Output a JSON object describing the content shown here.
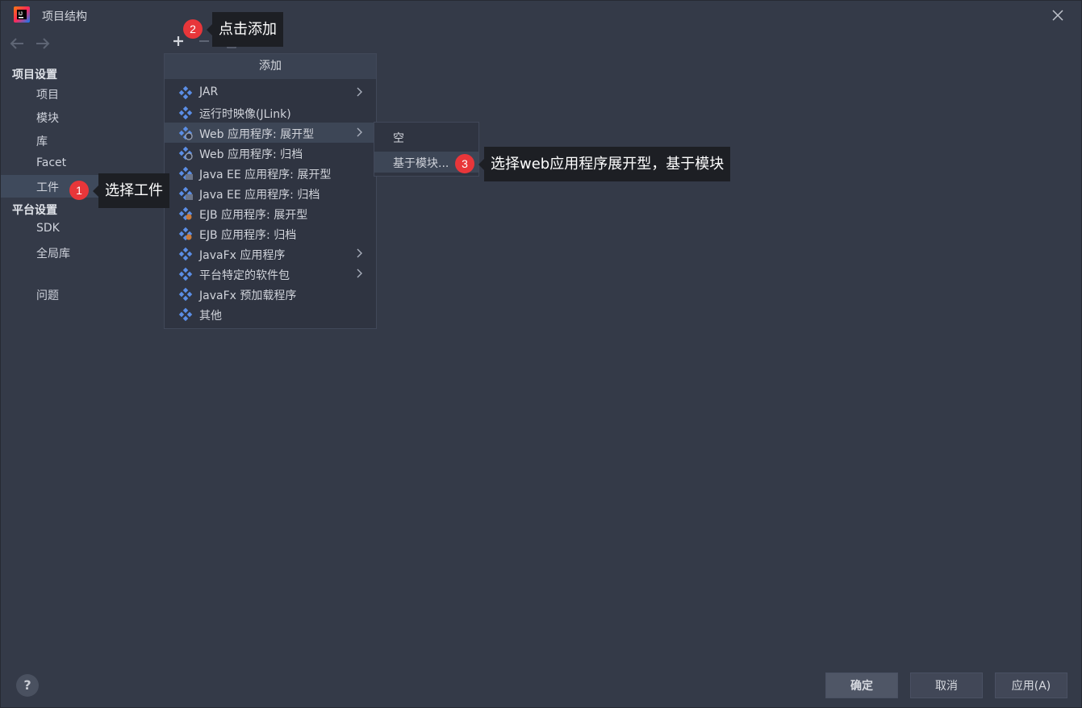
{
  "window": {
    "title": "项目结构",
    "app_icon": "intellij-icon",
    "close_icon": "close-icon"
  },
  "nav": {
    "back_icon": "arrow-left-icon",
    "forward_icon": "arrow-right-icon"
  },
  "sidebar": {
    "project_settings_header": "项目设置",
    "project_items": [
      "项目",
      "模块",
      "库",
      "Facet",
      "工件"
    ],
    "platform_settings_header": "平台设置",
    "platform_items": [
      "SDK",
      "全局库"
    ],
    "problems": "问题",
    "selected": "工件"
  },
  "toolbar": {
    "add_icon": "plus-icon",
    "remove_icon": "minus-icon",
    "copy_icon": "copy-icon"
  },
  "add_menu": {
    "header": "添加",
    "items": [
      {
        "label": "JAR",
        "icon": "jar-icon",
        "submenu": true
      },
      {
        "label": "运行时映像(JLink)",
        "icon": "jlink-icon",
        "submenu": false
      },
      {
        "label": "Web 应用程序: 展开型",
        "icon": "web-app-icon",
        "submenu": true,
        "highlighted": true
      },
      {
        "label": "Web 应用程序: 归档",
        "icon": "web-app-icon",
        "submenu": false
      },
      {
        "label": "Java EE 应用程序: 展开型",
        "icon": "javaee-icon",
        "submenu": false
      },
      {
        "label": "Java EE 应用程序: 归档",
        "icon": "javaee-icon",
        "submenu": false
      },
      {
        "label": "EJB 应用程序: 展开型",
        "icon": "ejb-icon",
        "submenu": false
      },
      {
        "label": "EJB 应用程序: 归档",
        "icon": "ejb-icon",
        "submenu": false
      },
      {
        "label": "JavaFx 应用程序",
        "icon": "javafx-icon",
        "submenu": true
      },
      {
        "label": "平台特定的软件包",
        "icon": "package-icon",
        "submenu": true
      },
      {
        "label": "JavaFx 预加载程序",
        "icon": "javafx-icon",
        "submenu": false
      },
      {
        "label": "其他",
        "icon": "other-icon",
        "submenu": false
      }
    ]
  },
  "submenu": {
    "items": [
      "空",
      "基于模块..."
    ]
  },
  "callouts": [
    {
      "number": "1",
      "text": "选择工件"
    },
    {
      "number": "2",
      "text": "点击添加"
    },
    {
      "number": "3",
      "text": "选择web应用程序展开型，基于模块"
    }
  ],
  "footer": {
    "help": "?",
    "ok": "确定",
    "cancel": "取消",
    "apply": "应用(A)"
  },
  "colors": {
    "background": "#343a48",
    "badge": "#e8363a",
    "callout_bg": "#1d1f24"
  }
}
